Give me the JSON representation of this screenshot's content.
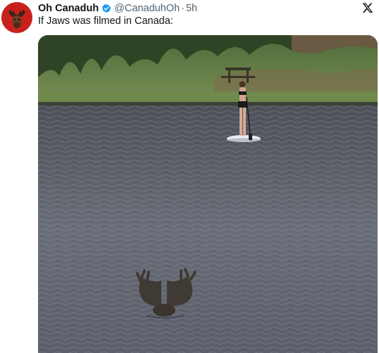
{
  "tweet": {
    "display_name": "Oh Canaduh",
    "handle": "@CanaduhOh",
    "separator": "·",
    "time": "5h",
    "text": "If Jaws was filmed in Canada:"
  },
  "icons": {
    "verified": "verified-badge-icon",
    "brand": "x-logo-icon",
    "avatar": "moose-avatar"
  },
  "colors": {
    "verified_blue": "#1d9bf0",
    "avatar_red": "#c8211d",
    "text_primary": "#0f1419",
    "text_secondary": "#536471"
  }
}
